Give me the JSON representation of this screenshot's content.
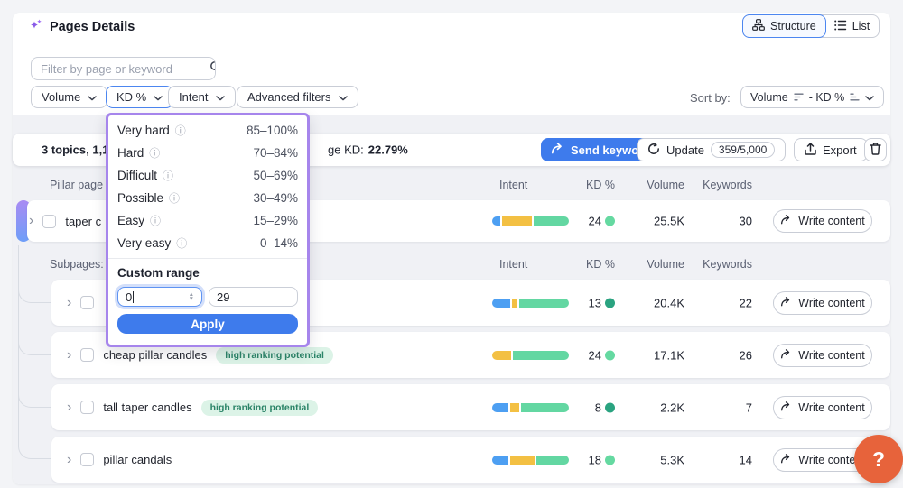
{
  "app": {
    "title": "Pages Details",
    "help_label": "?"
  },
  "view_toggle": {
    "structure": "Structure",
    "list": "List"
  },
  "filters": {
    "search_placeholder": "Filter by page or keyword",
    "volume": "Volume",
    "kd": "KD %",
    "intent": "Intent",
    "advanced": "Advanced filters",
    "sort_by_label": "Sort by:",
    "sort_part1": "Volume",
    "sort_part2": "- KD %"
  },
  "kd_dropdown": {
    "options": [
      {
        "label": "Very hard",
        "range": "85–100%"
      },
      {
        "label": "Hard",
        "range": "70–84%"
      },
      {
        "label": "Difficult",
        "range": "50–69%"
      },
      {
        "label": "Possible",
        "range": "30–49%"
      },
      {
        "label": "Easy",
        "range": "15–29%"
      },
      {
        "label": "Very easy",
        "range": "0–14%"
      }
    ],
    "custom_range_label": "Custom range",
    "min_value": "0",
    "max_value": "29",
    "apply_label": "Apply"
  },
  "summary": {
    "topics_text": "3 topics, 1,122",
    "avg_kd_label": "ge KD:",
    "avg_kd_value": "22.79%",
    "send_keywords_label": "Send keywords",
    "update_label": "Update",
    "update_quota": "359/5,000",
    "export_label": "Export"
  },
  "table": {
    "pillar_header": "Pillar page",
    "columns": {
      "intent": "Intent",
      "kd": "KD %",
      "volume": "Volume",
      "keywords": "Keywords"
    },
    "subpages_label": "Subpages:",
    "write_content_label": "Write content",
    "badge_text": "high ranking potential",
    "pillar_row": {
      "name": "taper c",
      "kd": "24",
      "kd_level": "light",
      "volume": "25.5K",
      "keywords": "30",
      "intent": [
        11,
        41,
        48
      ]
    },
    "subpage_rows": [
      {
        "name": "",
        "kd": "13",
        "kd_level": "dark",
        "volume": "20.4K",
        "keywords": "22",
        "intent": [
          25,
          7,
          68
        ]
      },
      {
        "name": "cheap pillar candles",
        "kd": "24",
        "kd_level": "light",
        "volume": "17.1K",
        "keywords": "26",
        "intent": [
          0,
          25,
          75
        ]
      },
      {
        "name": "tall taper candles",
        "kd": "8",
        "kd_level": "dark",
        "volume": "2.2K",
        "keywords": "7",
        "intent": [
          22,
          12,
          66
        ]
      },
      {
        "name": "pillar candals",
        "kd": "18",
        "kd_level": "light",
        "volume": "5.3K",
        "keywords": "14",
        "intent": [
          22,
          33,
          45
        ]
      }
    ]
  },
  "colors": {
    "primary_blue": "#3E7BEC",
    "panel_border_purple": "#A685EC",
    "help_orange": "#E7633B",
    "intent_blue": "#4D9FF2",
    "intent_yellow": "#F3C043",
    "intent_green": "#63D7A2",
    "kd_dot_dark": "#2AA380",
    "kd_dot_light": "#65D9A1",
    "badge_bg": "#DCF3E7",
    "badge_text_color": "#2B8468",
    "accent_gradient_top": "#A98BF3",
    "accent_gradient_bottom": "#6E9EF8"
  },
  "icons": {
    "title": "sparkles-icon",
    "search": "search-icon",
    "dropdown": "chevron-down-icon",
    "structure": "org-chart-icon",
    "list": "list-icon",
    "sort": "sort-lines-icon",
    "send": "curved-arrow-icon",
    "update": "refresh-icon",
    "export": "upload-icon",
    "delete": "trash-icon",
    "row_expand": "chevron-right-icon",
    "info": "info-icon",
    "help": "question-mark-icon"
  }
}
